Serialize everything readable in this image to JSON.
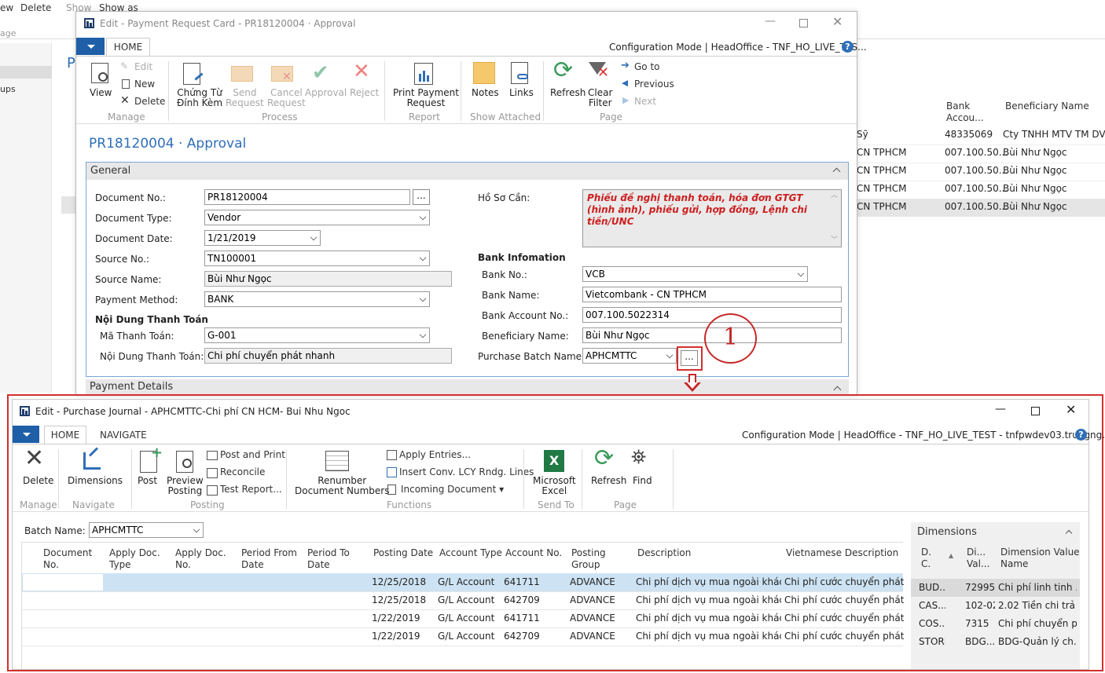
{
  "bg": {
    "top": [
      "ew",
      "Delete",
      "Show",
      "Show as",
      "Notes",
      "Links",
      "Refresh",
      "Clear",
      "Find"
    ],
    "left": [
      "age",
      "ups"
    ],
    "table": {
      "h1": "Bank",
      "h2": "Accou...",
      "h3": "Beneficiary Name",
      "rows": [
        [
          "Sỹ",
          "48335069",
          "Cty TNHH MTV TM DV V"
        ],
        [
          "CN TPHCM",
          "007.100.50...",
          "Bùi Như Ngọc"
        ],
        [
          "CN TPHCM",
          "007.100.50...",
          "Bùi Như Ngọc"
        ],
        [
          "CN TPHCM",
          "007.100.50...",
          "Bùi Như Ngọc"
        ],
        [
          "CN TPHCM",
          "007.100.50...",
          "Bùi Như Ngọc"
        ]
      ]
    }
  },
  "w1": {
    "title": "Edit - Payment Request Card - PR18120004 · Approval",
    "tab": "HOME",
    "config": "Configuration Mode | HeadOffice - TNF_HO_LIVE_TES...",
    "ribbon": {
      "view": "View",
      "edit": "Edit",
      "new": "New",
      "delete": "Delete",
      "manage": "Manage",
      "chungtu1": "Chứng Từ",
      "chungtu2": "Đính Kèm",
      "send1": "Send",
      "send2": "Request",
      "cancel1": "Cancel",
      "cancel2": "Request",
      "approval": "Approval",
      "reject": "Reject",
      "process": "Process",
      "print1": "Print Payment",
      "print2": "Request",
      "report": "Report",
      "notes": "Notes",
      "links": "Links",
      "showatt": "Show Attached",
      "refresh": "Refresh",
      "clear1": "Clear",
      "clear2": "Filter",
      "goto": "Go to",
      "previous": "Previous",
      "next": "Next",
      "page": "Page"
    },
    "heading": "PR18120004 · Approval",
    "general": "General",
    "fields": {
      "docno_l": "Document No.:",
      "docno": "PR18120004",
      "doctype_l": "Document Type:",
      "doctype": "Vendor",
      "docdate_l": "Document Date:",
      "docdate": "1/21/2019",
      "srcno_l": "Source No.:",
      "srcno": "TN100001",
      "srcname_l": "Source Name:",
      "srcname": "Bùi Như Ngọc",
      "paym_l": "Payment Method:",
      "paym": "BANK",
      "ndtt_h": "Nội Dung Thanh Toán",
      "matt_l": "Mã Thanh Toán:",
      "matt": "G-001",
      "ndtt_l": "Nội Dung Thanh Toán:",
      "ndtt": "Chi phí chuyển phát nhanh",
      "hoso_l": "Hồ Sơ Cần:",
      "hoso": "Phiếu đề nghị thanh toán, hóa đơn GTGT (hình ảnh), phiếu gửi, hợp đồng, Lệnh chi tiền/UNC",
      "bankinfo": "Bank Infomation",
      "bankno_l": "Bank No.:",
      "bankno": "VCB",
      "bankname_l": "Bank Name:",
      "bankname": "Vietcombank - CN TPHCM",
      "bankacc_l": "Bank Account No.:",
      "bankacc": "007.100.5022314",
      "benef_l": "Beneficiary Name:",
      "benef": "Bùi Như Ngọc",
      "batch_l": "Purchase Batch Name:",
      "batch": "APHCMTTC"
    },
    "payment_details": "Payment Details",
    "annotation": "1"
  },
  "w2": {
    "title": "Edit - Purchase Journal - APHCMTTC-Chi phí CN HCM- Bui Nhu Ngoc",
    "tabs": [
      "HOME",
      "NAVIGATE"
    ],
    "config": "Configuration Mode | HeadOffice - TNF_HO_LIVE_TEST - tnfpwdev03.trungng...",
    "ribbon": {
      "delete": "Delete",
      "manage": "Manage",
      "dimensions": "Dimensions",
      "navigate": "Navigate",
      "post": "Post",
      "preview1": "Preview",
      "preview2": "Posting",
      "postprint": "Post and Print",
      "reconcile": "Reconcile",
      "testreport": "Test Report...",
      "posting": "Posting",
      "renum1": "Renumber",
      "renum2": "Document Numbers",
      "apply": "Apply Entries...",
      "insconv": "Insert Conv. LCY Rndg. Lines",
      "incoming": "Incoming Document ▾",
      "functions": "Functions",
      "excel1": "Microsoft",
      "excel2": "Excel",
      "sendto": "Send To",
      "refresh": "Refresh",
      "find": "Find",
      "page": "Page"
    },
    "batch_l": "Batch Name:",
    "batch": "APHCMTTC",
    "cols": [
      "Document No.",
      "Apply Doc. Type",
      "Apply Doc. No.",
      "Period From Date",
      "Period To Date",
      "Posting Date",
      "Account Type",
      "Account No.",
      "Posting Group",
      "Description",
      "Vietnamese Description"
    ],
    "rows": [
      [
        "12/25/2018",
        "G/L Account",
        "641711",
        "ADVANCE",
        "Chi phí dịch vụ mua ngoài khác",
        "Chi phí cước chuyển phát nhanh"
      ],
      [
        "12/25/2018",
        "G/L Account",
        "642709",
        "ADVANCE",
        "Chi phí dịch vụ mua ngoài khác",
        "Chi phí cước chuyển phát nhanh"
      ],
      [
        "1/22/2019",
        "G/L Account",
        "641711",
        "ADVANCE",
        "Chi phí dịch vụ mua ngoài khác",
        "Chi phí cước chuyển phát nhanh"
      ],
      [
        "1/22/2019",
        "G/L Account",
        "642709",
        "ADVANCE",
        "Chi phí dịch vụ mua ngoài khác",
        "Chi phí cước chuyển phát nhanh"
      ]
    ],
    "dims": {
      "title": "Dimensions",
      "h1": "D.",
      "h1b": "C.",
      "h2": "Di...",
      "h2b": "Val...",
      "h3": "Dimension Value",
      "h3b": "Name",
      "rows": [
        [
          "BUD...",
          "72995",
          "Chi phí linh tinh ..."
        ],
        [
          "CAS...",
          "102-02",
          "2.02 Tiền chi trả ..."
        ],
        [
          "COS...",
          "7315",
          "Chi phí chuyển p..."
        ],
        [
          "STORE",
          "BDG...",
          "BDG-Quản lý ch..."
        ]
      ]
    }
  }
}
